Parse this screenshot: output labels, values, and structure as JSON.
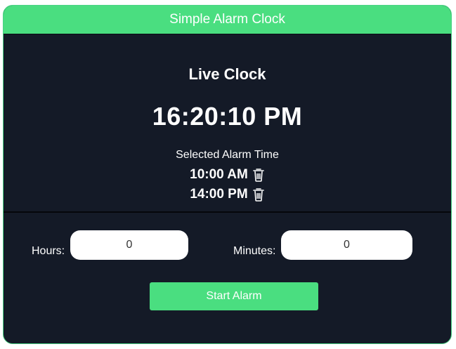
{
  "header": {
    "title": "Simple Alarm Clock"
  },
  "clock": {
    "heading": "Live Clock",
    "time": "16:20:10 PM",
    "alarm_label": "Selected Alarm Time",
    "alarms": [
      "10:00 AM",
      "14:00 PM"
    ]
  },
  "controls": {
    "hours_label": "Hours:",
    "hours_value": "0",
    "minutes_label": "Minutes:",
    "minutes_value": "0",
    "start_label": "Start Alarm"
  },
  "colors": {
    "accent": "#4ade80",
    "panel": "#141a27",
    "text": "#ffffff"
  },
  "icons": {
    "delete": "trash-icon"
  }
}
